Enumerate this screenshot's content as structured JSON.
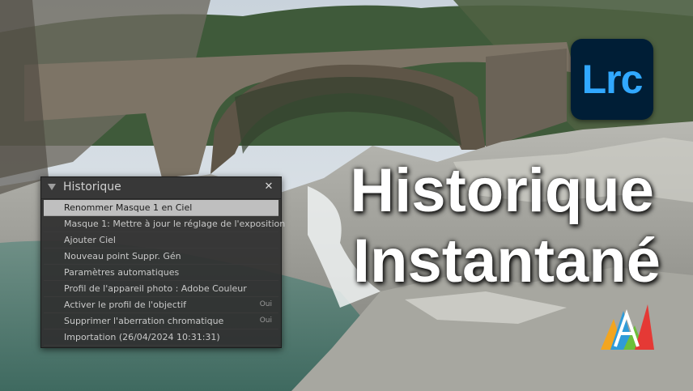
{
  "logo": {
    "text": "Lrc",
    "background": "#001e36",
    "text_color": "#31a8ff"
  },
  "headline": {
    "line1": "Historique",
    "line2": "Instantané"
  },
  "history_panel": {
    "title": "Historique",
    "collapse_icon": "triangle-down-icon",
    "close_icon": "close-icon",
    "items": [
      {
        "label": "Renommer Masque 1 en Ciel",
        "value": "",
        "selected": true
      },
      {
        "label": "Masque 1: Mettre à jour le réglage de l'exposition",
        "value": ""
      },
      {
        "label": "Ajouter Ciel",
        "value": ""
      },
      {
        "label": "Nouveau point Suppr. Gén",
        "value": ""
      },
      {
        "label": "Paramètres automatiques",
        "value": ""
      },
      {
        "label": "Profil de l'appareil photo : Adobe Couleur",
        "value": ""
      },
      {
        "label": "Activer le profil de l'objectif",
        "value": "Oui"
      },
      {
        "label": "Supprimer l'aberration chromatique",
        "value": "Oui"
      },
      {
        "label": "Importation (26/04/2024 10:31:31)",
        "value": ""
      }
    ]
  },
  "colors": {
    "panel_bg": "#2f2f2f",
    "selected_row": "#bfbfbf",
    "headline": "#ffffff"
  }
}
